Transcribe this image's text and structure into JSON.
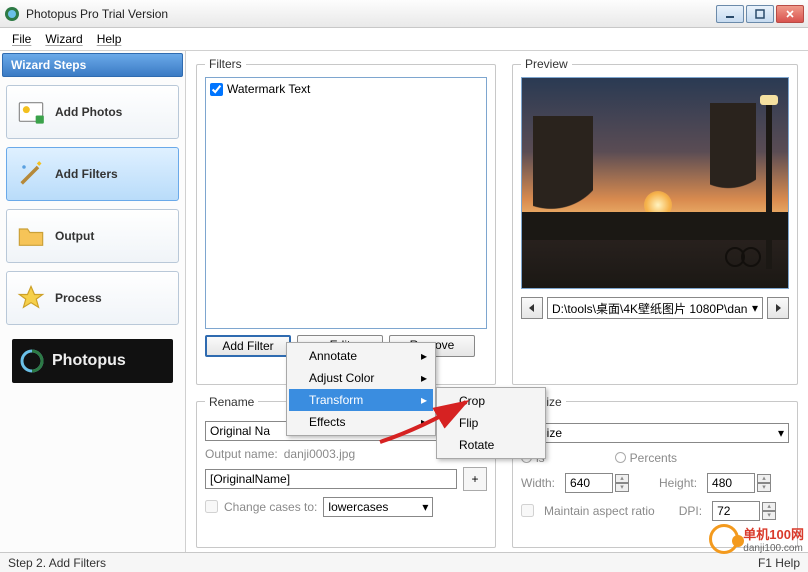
{
  "window": {
    "title": "Photopus Pro Trial Version"
  },
  "menubar": {
    "file": "File",
    "wizard": "Wizard",
    "help": "Help"
  },
  "sidebar": {
    "header": "Wizard Steps",
    "steps": [
      {
        "label": "Add Photos"
      },
      {
        "label": "Add Filters"
      },
      {
        "label": "Output"
      },
      {
        "label": "Process"
      }
    ],
    "brand": "Photopus"
  },
  "filters": {
    "legend": "Filters",
    "items": [
      {
        "label": "Watermark Text",
        "checked": true
      }
    ],
    "add_btn": "Add Filter",
    "edit_btn": "Edit",
    "remove_btn": "Remove"
  },
  "preview": {
    "legend": "Preview",
    "path": "D:\\tools\\桌面\\4K壁纸图片 1080P\\dan"
  },
  "rename": {
    "legend": "Rename",
    "orig_label": "Original Na",
    "output_label": "Output name:",
    "output_value": "danji0003.jpg",
    "template": "[OriginalName]",
    "change_cases_label": "Change cases to:",
    "case_option": "lowercases"
  },
  "resize": {
    "legend": "Resize",
    "size_label": "al Size",
    "pixels_label": "ls",
    "percents_label": "Percents",
    "width_label": "Width:",
    "width_value": "640",
    "height_label": "Height:",
    "height_value": "480",
    "aspect_label": "Maintain aspect ratio",
    "dpi_label": "DPI:",
    "dpi_value": "72"
  },
  "context_menu": {
    "items": [
      {
        "label": "Annotate",
        "has_sub": true
      },
      {
        "label": "Adjust Color",
        "has_sub": true
      },
      {
        "label": "Transform",
        "has_sub": true,
        "hover": true
      },
      {
        "label": "Effects",
        "has_sub": true
      }
    ],
    "submenu": [
      {
        "label": "Crop"
      },
      {
        "label": "Flip"
      },
      {
        "label": "Rotate"
      }
    ]
  },
  "statusbar": {
    "left": "Step 2. Add Filters",
    "right": "F1 Help"
  },
  "corner": {
    "line1": "单机100网",
    "line2": "danji100.com"
  }
}
